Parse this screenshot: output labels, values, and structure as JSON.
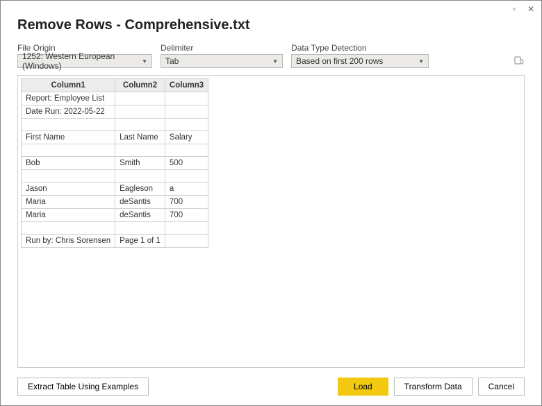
{
  "window_title": "Remove Rows - Comprehensive.txt",
  "titlebar": {
    "maximize_symbol": "▫",
    "close_symbol": "✕"
  },
  "controls": {
    "file_origin": {
      "label": "File Origin",
      "value": "1252: Western European (Windows)"
    },
    "delimiter": {
      "label": "Delimiter",
      "value": "Tab"
    },
    "detection": {
      "label": "Data Type Detection",
      "value": "Based on first 200 rows"
    }
  },
  "table": {
    "headers": [
      "Column1",
      "Column2",
      "Column3"
    ],
    "rows": [
      [
        "Report: Employee List",
        "",
        ""
      ],
      [
        "Date Run: 2022-05-22",
        "",
        ""
      ],
      [
        "",
        "",
        ""
      ],
      [
        "First Name",
        "Last Name",
        "Salary"
      ],
      [
        "",
        "",
        ""
      ],
      [
        "Bob",
        "Smith",
        "500"
      ],
      [
        "",
        "",
        ""
      ],
      [
        "Jason",
        "Eagleson",
        "a"
      ],
      [
        "Maria",
        "deSantis",
        "700"
      ],
      [
        "Maria",
        "deSantis",
        "700"
      ],
      [
        "",
        "",
        ""
      ],
      [
        "Run by: Chris Sorensen",
        "Page 1 of 1",
        ""
      ]
    ]
  },
  "footer": {
    "extract_label": "Extract Table Using Examples",
    "load_label": "Load",
    "transform_label": "Transform Data",
    "cancel_label": "Cancel"
  }
}
